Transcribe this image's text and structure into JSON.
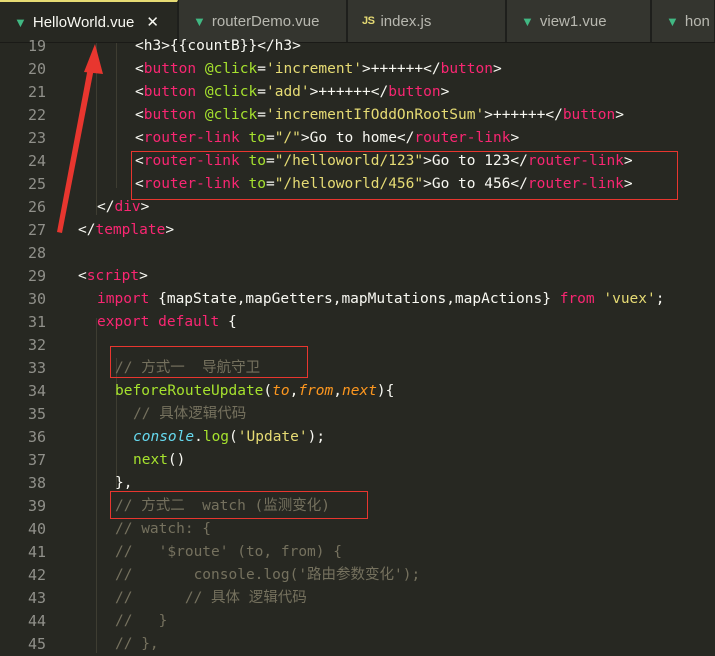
{
  "tabs": [
    {
      "label": "HelloWorld.vue",
      "icon": "vue-icon",
      "active": true,
      "close": "✕"
    },
    {
      "label": "routerDemo.vue",
      "icon": "vue-icon",
      "active": false
    },
    {
      "label": "index.js",
      "icon": "js-icon",
      "icon_text": "JS",
      "active": false
    },
    {
      "label": "view1.vue",
      "icon": "vue-icon",
      "active": false
    },
    {
      "label": "hon",
      "icon": "vue-icon",
      "active": false
    }
  ],
  "line_numbers": [
    "19",
    "20",
    "21",
    "22",
    "23",
    "24",
    "25",
    "26",
    "27",
    "28",
    "29",
    "30",
    "31",
    "32",
    "33",
    "34",
    "35",
    "36",
    "37",
    "38",
    "39",
    "40",
    "41",
    "42",
    "43",
    "44",
    "45"
  ],
  "code_lines": [
    {
      "n": "19",
      "tokens": [
        [
          "p",
          "<h3>{{countB}}</h3>"
        ]
      ]
    },
    {
      "n": "20",
      "tokens": [
        [
          "p",
          "<"
        ],
        [
          "t",
          "button"
        ],
        [
          "p",
          " "
        ],
        [
          "a",
          "@click"
        ],
        [
          "p",
          "="
        ],
        [
          "s",
          "'increment'"
        ],
        [
          "p",
          ">++++++</"
        ],
        [
          "t",
          "button"
        ],
        [
          "p",
          ">"
        ]
      ]
    },
    {
      "n": "21",
      "tokens": [
        [
          "p",
          "<"
        ],
        [
          "t",
          "button"
        ],
        [
          "p",
          " "
        ],
        [
          "a",
          "@click"
        ],
        [
          "p",
          "="
        ],
        [
          "s",
          "'add'"
        ],
        [
          "p",
          ">++++++</"
        ],
        [
          "t",
          "button"
        ],
        [
          "p",
          ">"
        ]
      ]
    },
    {
      "n": "22",
      "tokens": [
        [
          "p",
          "<"
        ],
        [
          "t",
          "button"
        ],
        [
          "p",
          " "
        ],
        [
          "a",
          "@click"
        ],
        [
          "p",
          "="
        ],
        [
          "s",
          "'incrementIfOddOnRootSum'"
        ],
        [
          "p",
          ">++++++</"
        ],
        [
          "t",
          "button"
        ],
        [
          "p",
          ">"
        ]
      ]
    },
    {
      "n": "23",
      "tokens": [
        [
          "p",
          "<"
        ],
        [
          "t",
          "router-link"
        ],
        [
          "p",
          " "
        ],
        [
          "a",
          "to"
        ],
        [
          "p",
          "="
        ],
        [
          "s",
          "\"/\""
        ],
        [
          "p",
          ">Go to home</"
        ],
        [
          "t",
          "router-link"
        ],
        [
          "p",
          ">"
        ]
      ]
    },
    {
      "n": "24",
      "tokens": [
        [
          "p",
          "<"
        ],
        [
          "t",
          "router-link"
        ],
        [
          "p",
          " "
        ],
        [
          "a",
          "to"
        ],
        [
          "p",
          "="
        ],
        [
          "s",
          "\"/helloworld/123\""
        ],
        [
          "p",
          ">Go to 123</"
        ],
        [
          "t",
          "router-link"
        ],
        [
          "p",
          ">"
        ]
      ]
    },
    {
      "n": "25",
      "tokens": [
        [
          "p",
          "<"
        ],
        [
          "t",
          "router-link"
        ],
        [
          "p",
          " "
        ],
        [
          "a",
          "to"
        ],
        [
          "p",
          "="
        ],
        [
          "s",
          "\"/helloworld/456\""
        ],
        [
          "p",
          ">Go to 456</"
        ],
        [
          "t",
          "router-link"
        ],
        [
          "p",
          ">"
        ]
      ]
    },
    {
      "n": "26",
      "tokens": [
        [
          "p",
          "</"
        ],
        [
          "t",
          "div"
        ],
        [
          "p",
          ">"
        ]
      ]
    },
    {
      "n": "27",
      "tokens": [
        [
          "p",
          "</"
        ],
        [
          "t",
          "template"
        ],
        [
          "p",
          ">"
        ]
      ]
    },
    {
      "n": "28",
      "tokens": []
    },
    {
      "n": "29",
      "tokens": [
        [
          "p",
          "<"
        ],
        [
          "t",
          "script"
        ],
        [
          "p",
          ">"
        ]
      ]
    },
    {
      "n": "30",
      "tokens": [
        [
          "k",
          "import"
        ],
        [
          "p",
          " {mapState,mapGetters,mapMutations,mapActions} "
        ],
        [
          "k",
          "from"
        ],
        [
          "p",
          " "
        ],
        [
          "s",
          "'vuex'"
        ],
        [
          "p",
          ";"
        ]
      ]
    },
    {
      "n": "31",
      "tokens": [
        [
          "k",
          "export"
        ],
        [
          "p",
          " "
        ],
        [
          "k",
          "default"
        ],
        [
          "p",
          " {"
        ]
      ]
    },
    {
      "n": "32",
      "tokens": []
    },
    {
      "n": "33",
      "tokens": [
        [
          "c",
          "// 方式一  导航守卫"
        ]
      ]
    },
    {
      "n": "34",
      "tokens": [
        [
          "fn",
          "beforeRouteUpdate"
        ],
        [
          "p",
          "("
        ],
        [
          "par",
          "to"
        ],
        [
          "p",
          ","
        ],
        [
          "par",
          "from"
        ],
        [
          "p",
          ","
        ],
        [
          "par",
          "next"
        ],
        [
          "p",
          "){"
        ]
      ]
    },
    {
      "n": "35",
      "tokens": [
        [
          "c",
          "// 具体逻辑代码"
        ]
      ]
    },
    {
      "n": "36",
      "tokens": [
        [
          "i",
          "console"
        ],
        [
          "p",
          "."
        ],
        [
          "fn",
          "log"
        ],
        [
          "p",
          "("
        ],
        [
          "s",
          "'Update'"
        ],
        [
          "p",
          ");"
        ]
      ]
    },
    {
      "n": "37",
      "tokens": [
        [
          "fn",
          "next"
        ],
        [
          "p",
          "()"
        ]
      ]
    },
    {
      "n": "38",
      "tokens": [
        [
          "p",
          "},"
        ]
      ]
    },
    {
      "n": "39",
      "tokens": [
        [
          "c",
          "// 方式二  watch (监测变化)"
        ]
      ]
    },
    {
      "n": "40",
      "tokens": [
        [
          "c",
          "// watch: {"
        ]
      ]
    },
    {
      "n": "41",
      "tokens": [
        [
          "c",
          "//   '$route' (to, from) {"
        ]
      ]
    },
    {
      "n": "42",
      "tokens": [
        [
          "c",
          "//       console.log('路由参数变化');"
        ]
      ]
    },
    {
      "n": "43",
      "tokens": [
        [
          "c",
          "//      // 具体 逻辑代码"
        ]
      ]
    },
    {
      "n": "44",
      "tokens": [
        [
          "c",
          "//   }"
        ]
      ]
    },
    {
      "n": "45",
      "tokens": [
        [
          "c",
          "// },"
        ]
      ]
    }
  ],
  "colors": {
    "background": "#272822",
    "tag": "#f92672",
    "attribute": "#a6e22e",
    "string": "#e6db74",
    "comment": "#75715e",
    "annotation_red": "#e8362f"
  }
}
